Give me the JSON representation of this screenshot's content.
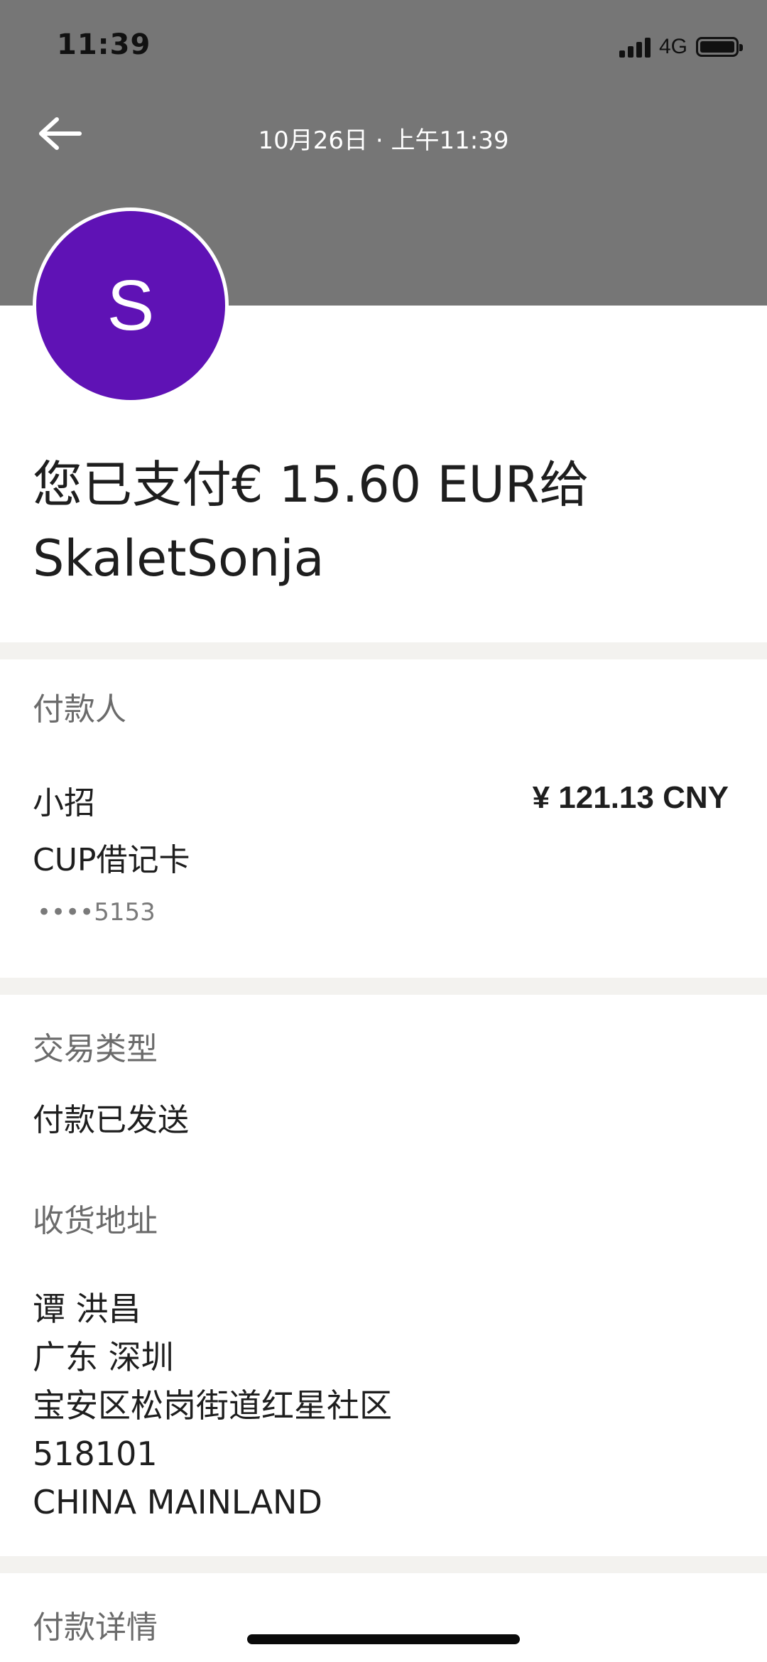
{
  "status_bar": {
    "time": "11:39",
    "network": "4G",
    "icons": [
      "signal-icon",
      "battery-icon"
    ]
  },
  "header": {
    "date": "10月26日 · 上午11:39",
    "back_icon": "arrow-left-icon",
    "background_color": "#767676"
  },
  "avatar": {
    "letter": "S",
    "color": "#5f12b5"
  },
  "title": {
    "line1": "您已支付€ 15.60 EUR给",
    "line2": "SkaletSonja"
  },
  "payer": {
    "label": "付款人",
    "name": "小招",
    "amount": "¥ 121.13 CNY",
    "card_type": "CUP借记卡",
    "card_number": "••••5153"
  },
  "transaction": {
    "type_label": "交易类型",
    "type_value": "付款已发送"
  },
  "shipping": {
    "label": "收货地址",
    "lines": [
      "谭 洪昌",
      "广东 深圳",
      "宝安区松岗街道红星社区",
      "518101",
      "CHINA MAINLAND"
    ]
  },
  "payment_details": {
    "label": "付款详情"
  }
}
